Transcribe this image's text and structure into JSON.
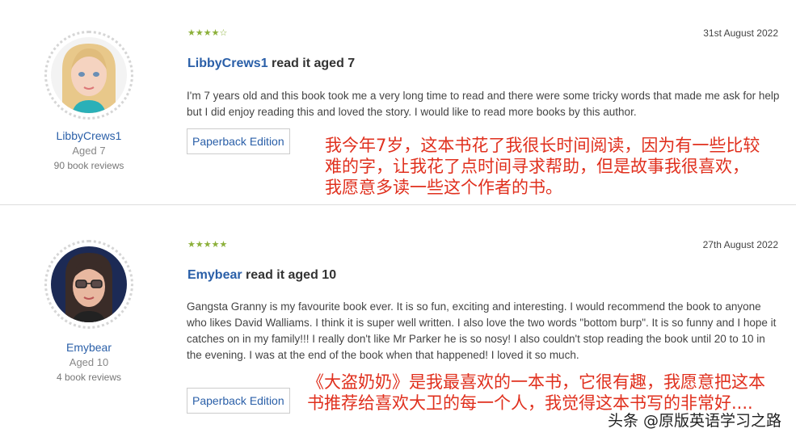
{
  "reviews": [
    {
      "user": "LibbyCrews1",
      "age": "Aged 7",
      "count": "90 book reviews",
      "stars": "★★★★☆",
      "rating": 4,
      "date": "31st August 2022",
      "headline_user": "LibbyCrews1",
      "headline_rest": " read it aged 7",
      "body": "I'm 7 years old and this book took me a very long time to read and there were some tricky words that made me ask for help but I did enjoy reading this and loved the story. I would like to read more books by this author.",
      "edition": "Paperback Edition",
      "translation": "我今年7岁，这本书花了我很长时间阅读，因为有一些比较难的字，让我花了点时间寻求帮助，但是故事我很喜欢，我愿意多读一些这个作者的书。"
    },
    {
      "user": "Emybear",
      "age": "Aged 10",
      "count": "4 book reviews",
      "stars": "★★★★★",
      "rating": 5,
      "date": "27th August 2022",
      "headline_user": "Emybear",
      "headline_rest": " read it aged 10",
      "body": "Gangsta Granny is my favourite book ever. It is so fun, exciting and interesting. I would recommend the book to anyone who likes David Walliams. I think it is super well written. I also love the two words \"bottom burp\". It is so funny and I hope it catches on in my family!!! I really don't like Mr Parker he is so nosy! I also couldn't stop reading the book until 20 to 10 in the evening. I was at the end of the book when that happened! I loved it so much.",
      "edition": "Paperback Edition",
      "translation": "《大盗奶奶》是我最喜欢的一本书，它很有趣，我愿意把这本书推荐给喜欢大卫的每一个人，我觉得这本书写的非常好...."
    }
  ],
  "watermark": "头条 @原版英语学习之路",
  "colors": {
    "star": "#8cb03a",
    "link": "#2a5fa8",
    "annotation": "#e0301e"
  }
}
